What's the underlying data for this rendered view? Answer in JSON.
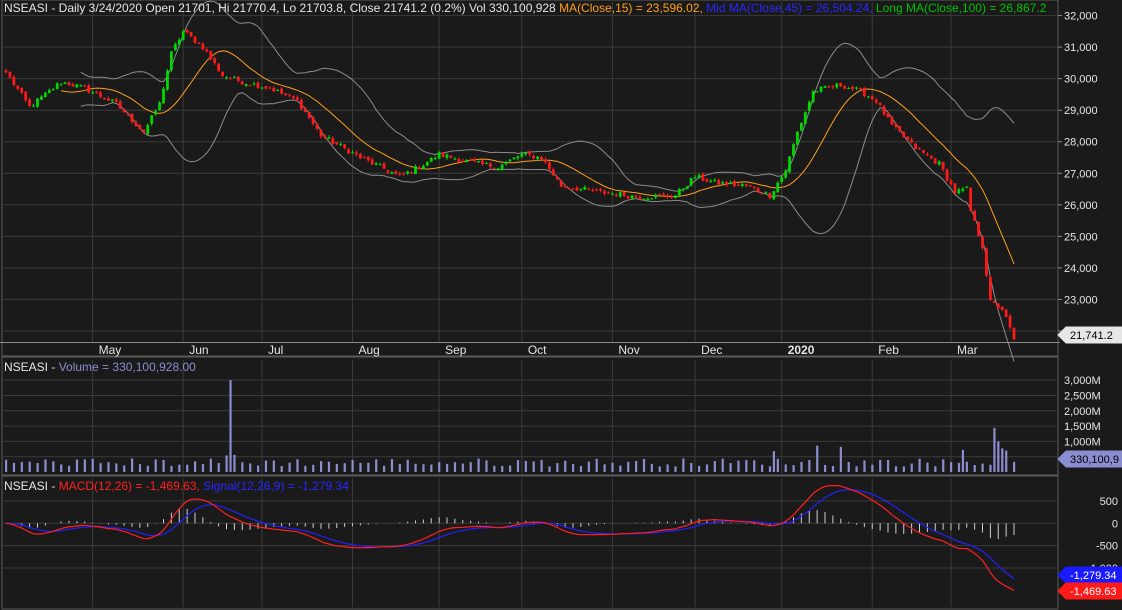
{
  "header": {
    "price": {
      "prefix": "NSEASI - Daily 3/24/2020 Open 21701, Hi 21770.4, Lo 21703.8, Close 21741.2 (0.2%) Vol 330,100,928 ",
      "ma15": "MA(Close,15) = 23,596.02, ",
      "ma45": "Mid MA(Close,45) = 26,504.24, ",
      "ma100": "Long MA(Close,100) = 26,867.2"
    },
    "volume": {
      "prefix": "NSEASI - ",
      "label": "Volume = 330,100,928.00"
    },
    "macd": {
      "prefix": "NSEASI - ",
      "macd": "MACD(12,26) = -1,469.63, ",
      "signal": "Signal(12,26,9) = -1,279.34"
    }
  },
  "colors": {
    "background": "#1a1a1a",
    "panel": "#1a1a1a",
    "grid": "#3a3a3a",
    "up": "#00d800",
    "down": "#ff1a1a",
    "ma15": "#ff9f1a",
    "ma45": "#1a1aff",
    "ma100": "#00c000",
    "bands": "#8c8c8c",
    "volume": "#8c8cd0",
    "macd": "#ff2020",
    "signal": "#2020ff",
    "hist": "#d0d0d0",
    "text": "#e6e6e6"
  },
  "chart_data": [
    {
      "type": "candlestick",
      "title": "NSEASI - Daily",
      "months": [
        "May",
        "Jun",
        "Jul",
        "Aug",
        "Sep",
        "Oct",
        "Nov",
        "Dec",
        "2020",
        "Feb",
        "Mar"
      ],
      "yticks": [
        "22,000",
        "23,000",
        "24,000",
        "25,000",
        "26,000",
        "27,000",
        "28,000",
        "29,000",
        "30,000",
        "31,000",
        "32,000"
      ],
      "ylim": [
        21650,
        32050
      ],
      "last_label": "21,741.2",
      "close_keypoints": [
        {
          "d": "2019-04-01",
          "v": 30200
        },
        {
          "d": "2019-04-09",
          "v": 29100
        },
        {
          "d": "2019-04-19",
          "v": 29900
        },
        {
          "d": "2019-04-29",
          "v": 29700
        },
        {
          "d": "2019-05-09",
          "v": 29200
        },
        {
          "d": "2019-05-20",
          "v": 28300
        },
        {
          "d": "2019-05-24",
          "v": 29200
        },
        {
          "d": "2019-05-29",
          "v": 30800
        },
        {
          "d": "2019-06-03",
          "v": 31500
        },
        {
          "d": "2019-06-10",
          "v": 31000
        },
        {
          "d": "2019-06-17",
          "v": 30100
        },
        {
          "d": "2019-06-24",
          "v": 29900
        },
        {
          "d": "2019-07-03",
          "v": 29700
        },
        {
          "d": "2019-07-12",
          "v": 29300
        },
        {
          "d": "2019-07-22",
          "v": 28200
        },
        {
          "d": "2019-08-05",
          "v": 27500
        },
        {
          "d": "2019-08-19",
          "v": 26900
        },
        {
          "d": "2019-08-26",
          "v": 27200
        },
        {
          "d": "2019-09-02",
          "v": 27600
        },
        {
          "d": "2019-09-16",
          "v": 27300
        },
        {
          "d": "2019-09-23",
          "v": 27200
        },
        {
          "d": "2019-10-01",
          "v": 27600
        },
        {
          "d": "2019-10-08",
          "v": 27500
        },
        {
          "d": "2019-10-15",
          "v": 26600
        },
        {
          "d": "2019-10-29",
          "v": 26400
        },
        {
          "d": "2019-11-12",
          "v": 26250
        },
        {
          "d": "2019-11-25",
          "v": 26300
        },
        {
          "d": "2019-12-02",
          "v": 26900
        },
        {
          "d": "2019-12-09",
          "v": 26700
        },
        {
          "d": "2019-12-19",
          "v": 26600
        },
        {
          "d": "2019-12-27",
          "v": 26300
        },
        {
          "d": "2020-01-02",
          "v": 27100
        },
        {
          "d": "2020-01-07",
          "v": 28300
        },
        {
          "d": "2020-01-13",
          "v": 29600
        },
        {
          "d": "2020-01-22",
          "v": 29800
        },
        {
          "d": "2020-01-29",
          "v": 29600
        },
        {
          "d": "2020-02-04",
          "v": 29300
        },
        {
          "d": "2020-02-10",
          "v": 28500
        },
        {
          "d": "2020-02-18",
          "v": 27800
        },
        {
          "d": "2020-02-26",
          "v": 27300
        },
        {
          "d": "2020-03-03",
          "v": 26400
        },
        {
          "d": "2020-03-06",
          "v": 26500
        },
        {
          "d": "2020-03-09",
          "v": 25800
        },
        {
          "d": "2020-03-12",
          "v": 24700
        },
        {
          "d": "2020-03-16",
          "v": 22900
        },
        {
          "d": "2020-03-19",
          "v": 22700
        },
        {
          "d": "2020-03-24",
          "v": 21741.2
        }
      ]
    },
    {
      "type": "bar",
      "title": "Volume",
      "yticks": [
        "500M",
        "1,000M",
        "1,500M",
        "2,000M",
        "2,500M",
        "3,000M"
      ],
      "ylim": [
        0,
        3200
      ],
      "unit": "M",
      "last_label": "330,100,9",
      "base_volume": 300,
      "spikes": [
        {
          "d": "2019-06-19",
          "v": 3000
        },
        {
          "d": "2019-06-18",
          "v": 540
        },
        {
          "d": "2019-06-20",
          "v": 560
        },
        {
          "d": "2019-12-30",
          "v": 680
        },
        {
          "d": "2020-01-14",
          "v": 860
        },
        {
          "d": "2020-01-22",
          "v": 820
        },
        {
          "d": "2020-03-05",
          "v": 720
        },
        {
          "d": "2020-03-17",
          "v": 1440
        },
        {
          "d": "2020-03-18",
          "v": 1000
        },
        {
          "d": "2020-03-19",
          "v": 770
        },
        {
          "d": "2020-03-20",
          "v": 700
        }
      ]
    },
    {
      "type": "line",
      "title": "MACD",
      "yticks": [
        "500",
        "0",
        "-500",
        "-1,000"
      ],
      "ylim": [
        -1650,
        700
      ],
      "series": [
        {
          "name": "MACD(12,26)"
        },
        {
          "name": "Signal(12,26,9)"
        }
      ],
      "last_macd_label": "-1,469.63",
      "last_signal_label": "-1,279.34"
    }
  ]
}
